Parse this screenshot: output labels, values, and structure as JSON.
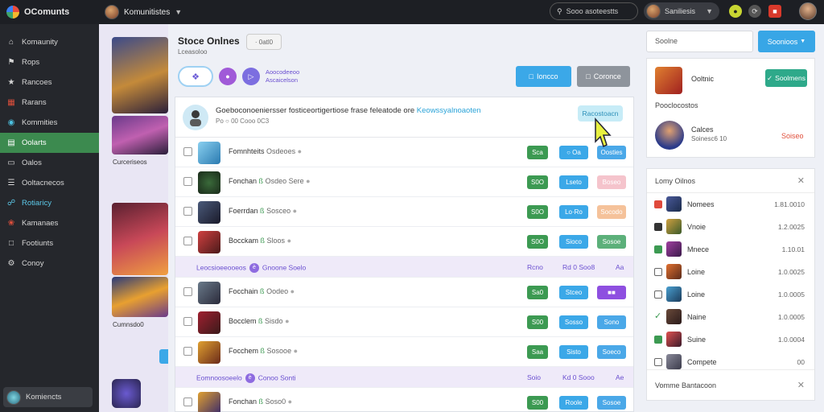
{
  "topbar": {
    "brand": "OComunts",
    "community_name": "Komunitistes",
    "search_label": "Sooo asoteestts",
    "user_name": "Saniliesis"
  },
  "sidebar": {
    "items": [
      {
        "label": "Komaunity",
        "icon": "home-icon"
      },
      {
        "label": "Rops",
        "icon": "tag-icon"
      },
      {
        "label": "Rancoes",
        "icon": "star-icon"
      },
      {
        "label": "Rarans",
        "icon": "grid-icon"
      },
      {
        "label": "Kommities",
        "icon": "chat-icon"
      },
      {
        "label": "Oolarts",
        "icon": "chart-icon",
        "active": true
      },
      {
        "label": "Oalos",
        "icon": "folder-icon"
      },
      {
        "label": "Ooltacnecos",
        "icon": "list-icon"
      },
      {
        "label": "Rotiaricy",
        "icon": "link-icon",
        "link": true
      },
      {
        "label": "Kamanaes",
        "icon": "flame-icon"
      },
      {
        "label": "Footiunts",
        "icon": "page-icon"
      },
      {
        "label": "Conoy",
        "icon": "settings-icon"
      }
    ],
    "footer_label": "Komiencts"
  },
  "strip": {
    "labels": [
      "Curceriseos",
      "Cumnsdo0"
    ]
  },
  "main": {
    "title": "Stoce Onlnes",
    "title_button": "· 0atl0",
    "subtitle": "Lceasoloo",
    "chip_text_1": "Aoocodeeoo",
    "chip_text_2": "Ascaicelson",
    "btn_primary": "Ioncco",
    "btn_secondary": "Coronce"
  },
  "table": {
    "header_text": "Goeboconoeniersser fosticeortigertiose frase feleatode ore ",
    "header_highlight": "Keowssyalnoaoten",
    "header_meta": "Po ○ 00 Cooo 0C3",
    "header_button": "Racostoacn",
    "rows": [
      {
        "type": "row",
        "name": "Fomnhteits",
        "sub": "Osdeoes",
        "ok": "",
        "green": "Sca",
        "blue": "○ Oa",
        "third": "Oosties",
        "third_color": "#4aa8e8"
      },
      {
        "type": "row",
        "name": "Fonchan",
        "sub": "Osdeo Sere",
        "ok": "ß",
        "green": "S0O",
        "blue": "Lseto",
        "third": "Boseo",
        "third_color": "#f5c4cc"
      },
      {
        "type": "row",
        "name": "Foerrdan",
        "sub": "Sosceo",
        "ok": "ß",
        "green": "S0O",
        "blue": "Lo·Ro",
        "third": "Socodo",
        "third_color": "#f5c29a"
      },
      {
        "type": "row",
        "name": "Bocckam",
        "sub": "Sloos",
        "ok": "ß",
        "green": "S0O",
        "blue": "Sioco",
        "third": "Sosoe",
        "third_color": "#5cb07a"
      },
      {
        "type": "section",
        "label": "Leocsioeeooeos",
        "badge": "è",
        "label2": "Gnoone Soelo",
        "c1": "Rcno",
        "c2": "Rd 0 Soo8",
        "c3": "Aa"
      },
      {
        "type": "row",
        "name": "Focchain",
        "sub": "Oodeo",
        "ok": "ß",
        "green": "Sa0",
        "blue": "Stceo",
        "third": "■■",
        "third_color": "#8e4fe0"
      },
      {
        "type": "row",
        "name": "Bocclem",
        "sub": "Sisdo",
        "ok": "ß",
        "green": "S00",
        "blue": "Sosso",
        "third": "Sono",
        "third_color": "#4aa8e8"
      },
      {
        "type": "row",
        "name": "Focchem",
        "sub": "Sosooe",
        "ok": "ß",
        "green": "Saa",
        "blue": "Sisto",
        "third": "Soeco",
        "third_color": "#4aa8e8"
      },
      {
        "type": "section",
        "label": "Eomnoosoeelo",
        "badge": "è",
        "label2": "Conoo Sonti",
        "c1": "Soio",
        "c2": "Kd 0 Sooo",
        "c3": "Ae"
      },
      {
        "type": "row",
        "name": "Fonchan",
        "sub": "Soso0",
        "ok": "ß",
        "green": "S00",
        "blue": "Roole",
        "third": "Sosoe",
        "third_color": "#4aa8e8"
      }
    ]
  },
  "right": {
    "search_value": "Soolne",
    "search_btn": "Soonioos",
    "card_name": "Ooltnic",
    "card_btn": "Soolmens",
    "card_section": "Pooclocostos",
    "profile_name": "Calces",
    "profile_sub": "Soinesc6 10",
    "profile_action": "Soiseo",
    "list_title": "Lomy Oilnos",
    "list": [
      {
        "name": "Nomees",
        "value": "1.81.0010",
        "mark": "#e04a3c"
      },
      {
        "name": "Vnoie",
        "value": "1.2.0025",
        "mark": "#333"
      },
      {
        "name": "Mnece",
        "value": "1.10.01",
        "mark": "#3c9a52"
      },
      {
        "name": "Loine",
        "value": "1.0.0025",
        "mark": "#fff"
      },
      {
        "name": "Loine",
        "value": "1.0.0005",
        "mark": "#fff"
      },
      {
        "name": "Naine",
        "value": "1.0.0005",
        "mark": "check"
      },
      {
        "name": "Suine",
        "value": "1.0.0004",
        "mark": "#3c9a52"
      },
      {
        "name": "Compete",
        "value": "00",
        "mark": "#fff"
      }
    ],
    "list_footer": "Vomme Bantacoon"
  }
}
